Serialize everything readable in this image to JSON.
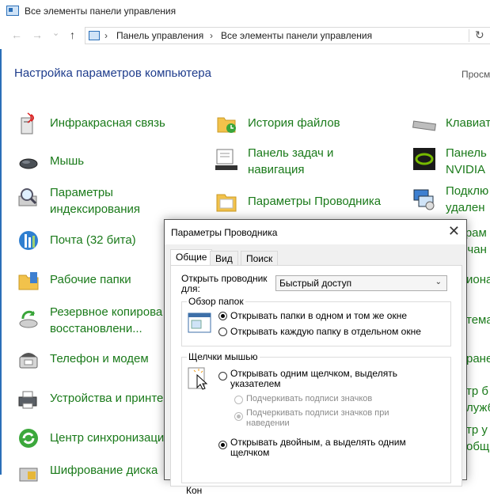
{
  "window_title": "Все элементы панели управления",
  "nav": {
    "back": "←",
    "forward": "→",
    "down": "⌄",
    "up": "↑",
    "refresh": "↻"
  },
  "address": {
    "crumbs": [
      "Панель управления",
      "Все элементы панели управления"
    ]
  },
  "heading": "Настройка параметров компьютера",
  "view_label": "Просм",
  "items_col1": [
    {
      "label": "Инфракрасная связь"
    },
    {
      "label": "Мышь"
    },
    {
      "label": "Параметры\nиндексирования"
    },
    {
      "label": "Почта (32 бита)"
    },
    {
      "label": "Рабочие папки"
    },
    {
      "label": "Резервное копирова\nвосстановлени..."
    },
    {
      "label": "Телефон и модем"
    },
    {
      "label": "Устройства и принте"
    },
    {
      "label": "Центр синхронизаци"
    },
    {
      "label": "Шифрование диска"
    }
  ],
  "items_col2": [
    {
      "label": "История файлов"
    },
    {
      "label": "Панель задач и\nнавигация"
    },
    {
      "label": "Параметры Проводника"
    }
  ],
  "items_col3": [
    {
      "label": "Клавиат"
    },
    {
      "label": "Панель\nNVIDIA"
    },
    {
      "label": "Подклю\nудален"
    },
    {
      "label": "ограм\nолчан"
    },
    {
      "label": "иона"
    },
    {
      "label": "тема"
    },
    {
      "label": "ране"
    },
    {
      "label": "тр б\nлужб"
    },
    {
      "label": "тр у\nобщ"
    }
  ],
  "dialog": {
    "title": "Параметры Проводника",
    "close": "✕",
    "tabs": [
      "Общие",
      "Вид",
      "Поиск"
    ],
    "open_label": "Открыть проводник\nдля:",
    "open_value": "Быстрый доступ",
    "browse_group": "Обзор папок",
    "browse_options": [
      "Открывать папки в одном и том же окне",
      "Открывать каждую папку в отдельном окне"
    ],
    "click_group": "Щелчки мышью",
    "click_single": "Открывать одним щелчком, выделять\nуказателем",
    "underline_always": "Подчеркивать подписи значков",
    "underline_hover": "Подчеркивать подписи значков при\nнаведении",
    "click_double": "Открывать двойным, а выделять одним\nщелчком",
    "bottom_partial": "Кон"
  }
}
